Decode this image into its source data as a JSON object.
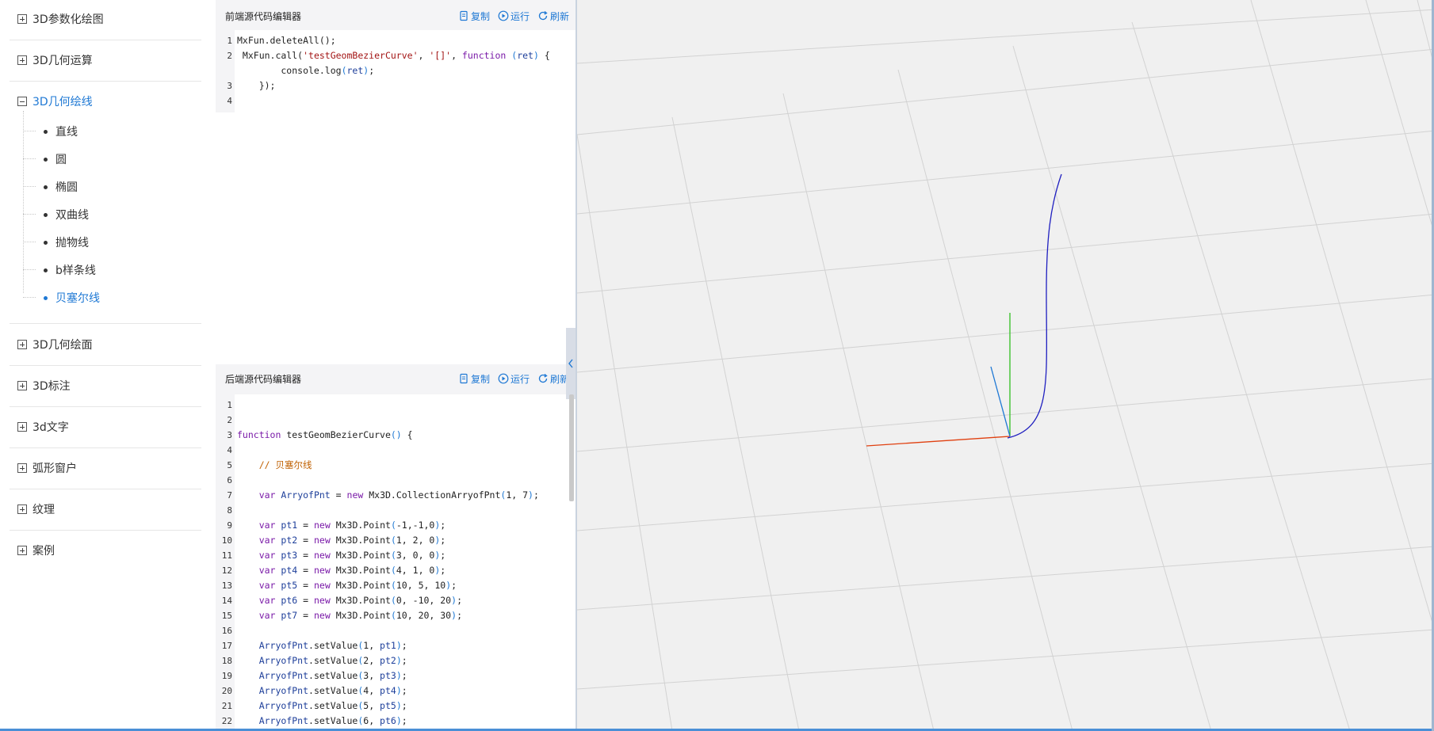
{
  "sidebar": {
    "groups": [
      {
        "label": "3D参数化绘图",
        "expanded": false
      },
      {
        "label": "3D几何运算",
        "expanded": false
      },
      {
        "label": "3D几何绘线",
        "expanded": true
      },
      {
        "label": "3D几何绘面",
        "expanded": false
      },
      {
        "label": "3D标注",
        "expanded": false
      },
      {
        "label": "3d文字",
        "expanded": false
      },
      {
        "label": "弧形窗户",
        "expanded": false
      },
      {
        "label": "纹理",
        "expanded": false
      },
      {
        "label": "案例",
        "expanded": false
      }
    ],
    "items": [
      {
        "label": "直线"
      },
      {
        "label": "圆"
      },
      {
        "label": "椭圆"
      },
      {
        "label": "双曲线"
      },
      {
        "label": "抛物线"
      },
      {
        "label": "b样条线"
      },
      {
        "label": "贝塞尔线",
        "active": true
      }
    ]
  },
  "frontend_editor": {
    "title": "前端源代码编辑器",
    "copy_label": "复制",
    "run_label": "运行",
    "refresh_label": "刷新",
    "lines": [
      "1",
      "2",
      "3",
      "4"
    ]
  },
  "backend_editor": {
    "title": "后端源代码编辑器",
    "copy_label": "复制",
    "run_label": "运行",
    "refresh_label": "刷新",
    "lines": [
      "1",
      "2",
      "3",
      "4",
      "5",
      "6",
      "7",
      "8",
      "9",
      "10",
      "11",
      "12",
      "13",
      "14",
      "15",
      "16",
      "17",
      "18",
      "19",
      "20",
      "21",
      "22"
    ],
    "comment_text": "// 贝塞尔线"
  },
  "colors": {
    "accent": "#1e78d4",
    "curve": "#2020c0",
    "axis_x": "#e04010",
    "axis_y": "#30c020",
    "axis_z": "#1e78d4"
  }
}
